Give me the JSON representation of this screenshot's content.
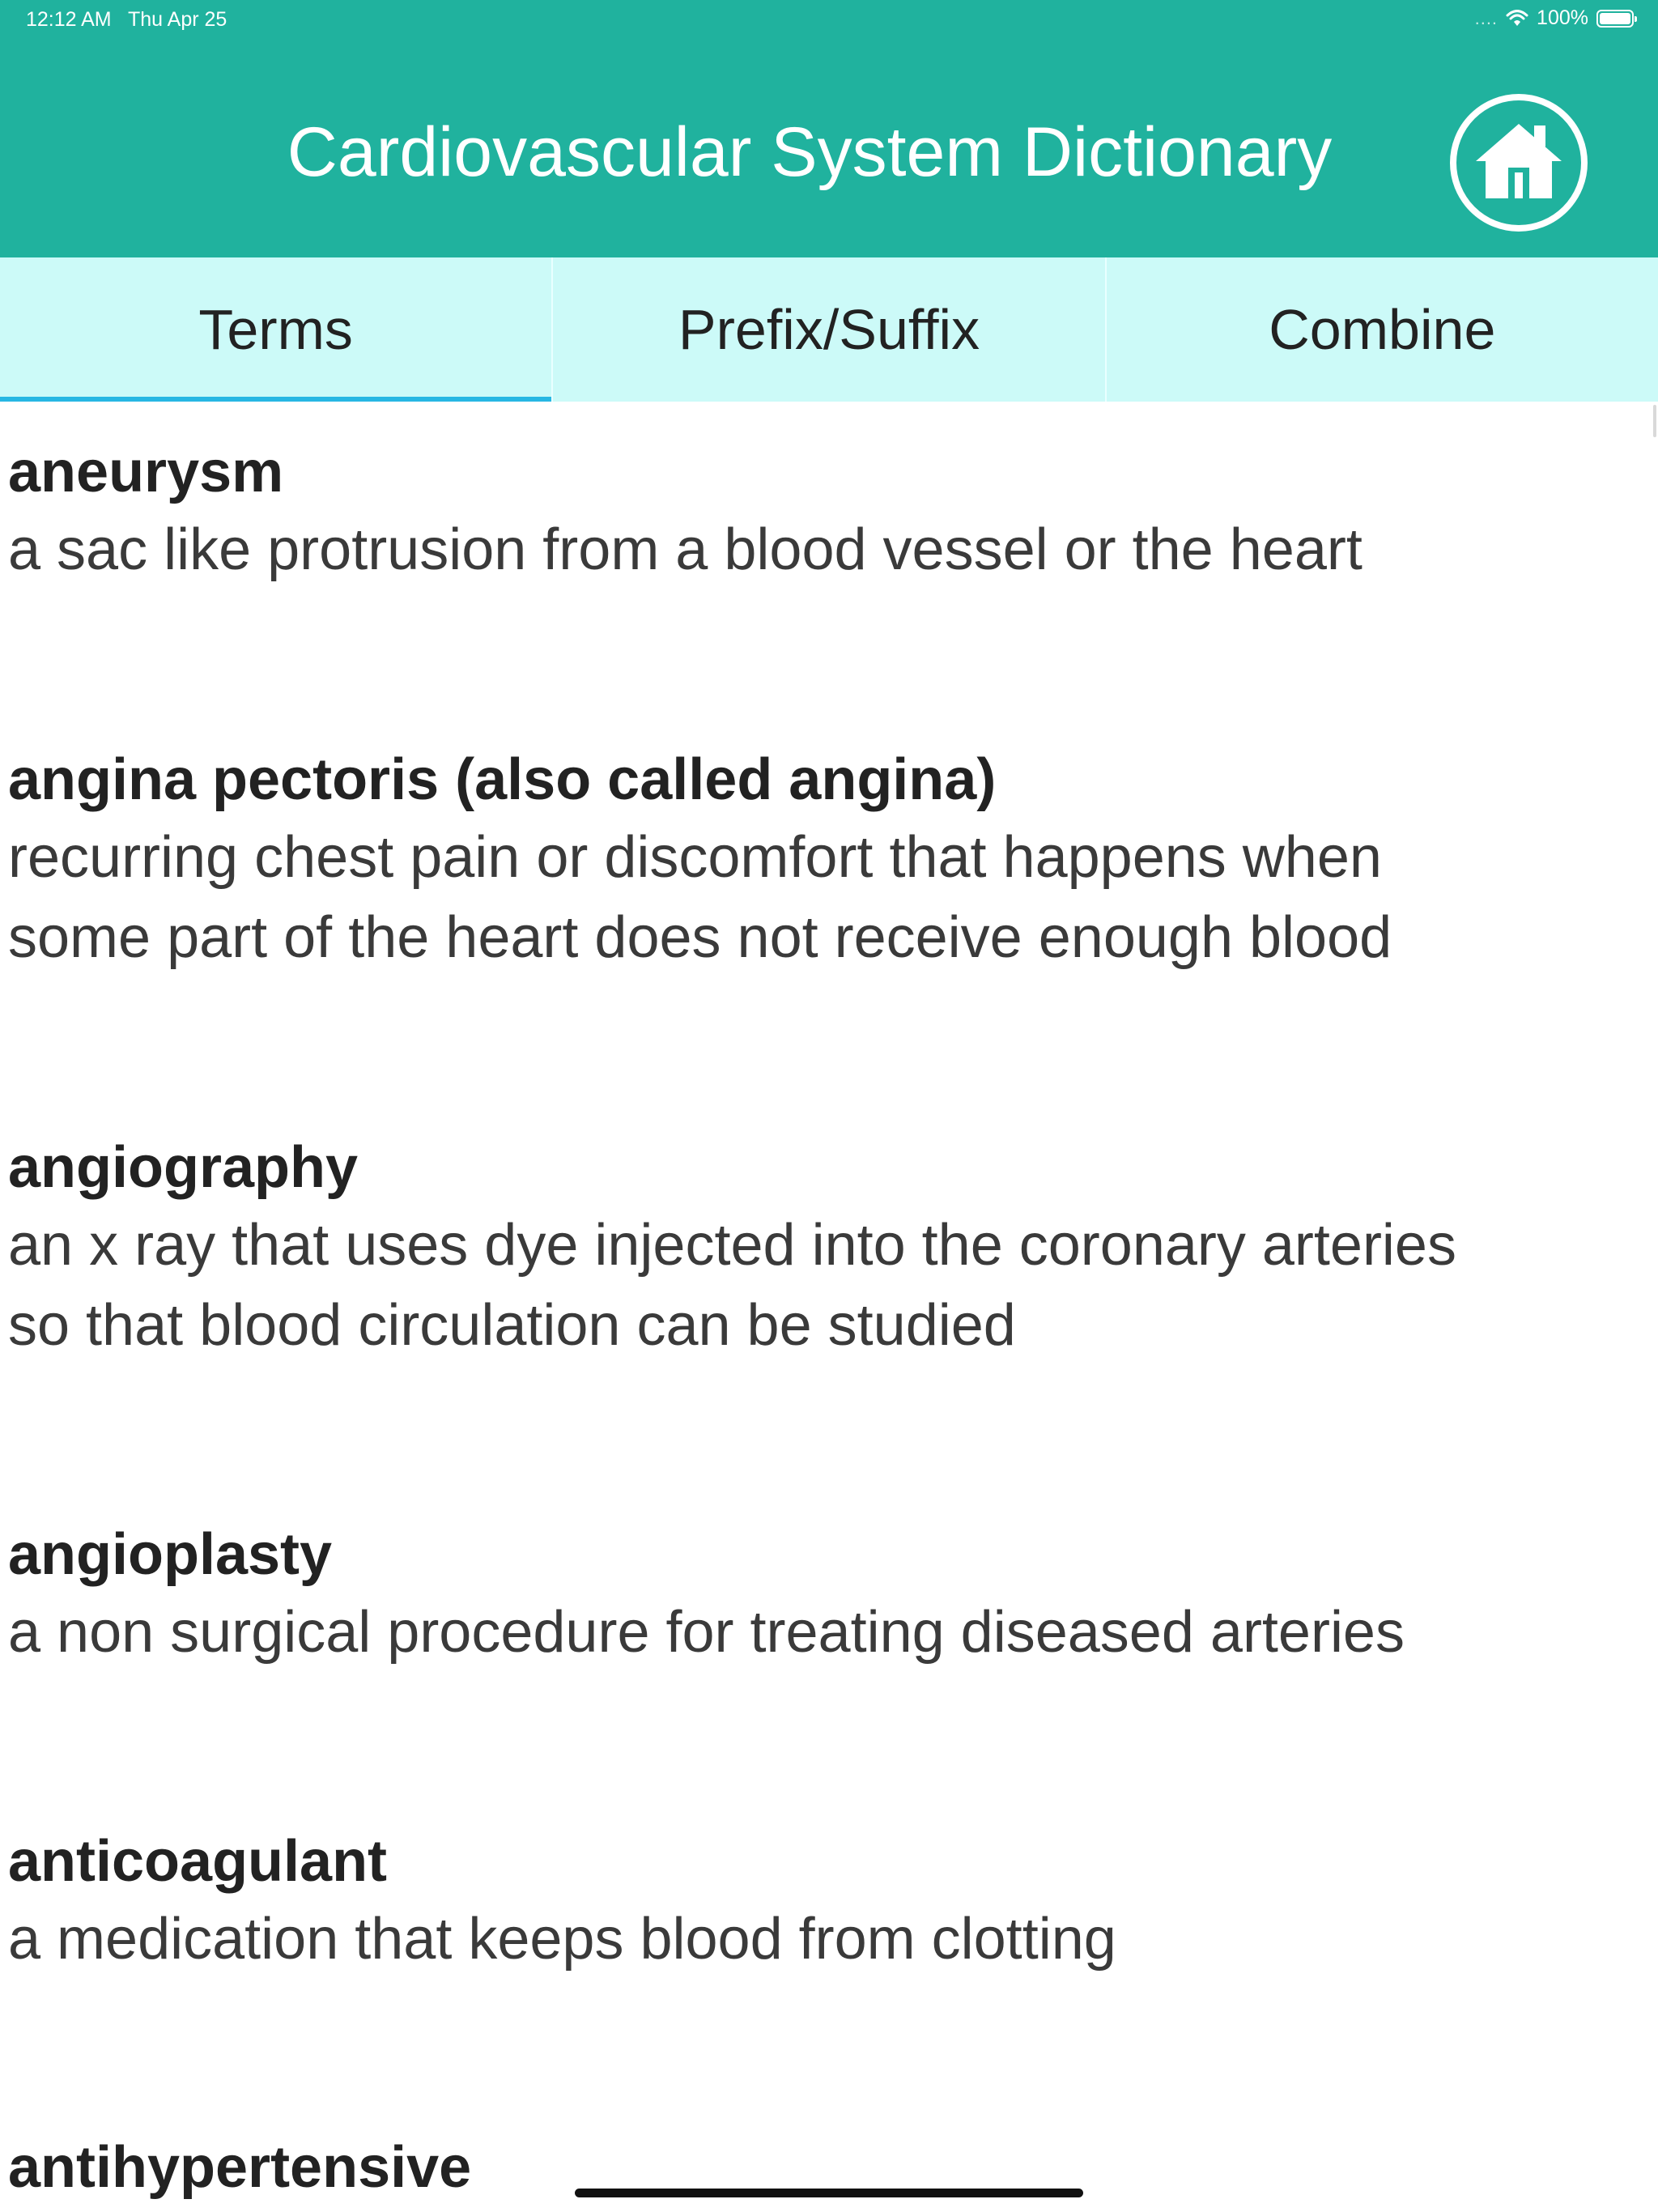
{
  "status_bar": {
    "time": "12:12 AM",
    "date": "Thu Apr 25",
    "signal": "....",
    "battery_percent": "100%"
  },
  "header": {
    "title": "Cardiovascular System Dictionary",
    "home_icon": "home-icon",
    "background_color": "#20b29e"
  },
  "tabs": [
    {
      "label": "Terms",
      "active": true
    },
    {
      "label": "Prefix/Suffix",
      "active": false
    },
    {
      "label": "Combine",
      "active": false
    }
  ],
  "entries": [
    {
      "term": "aneurysm",
      "definition_lines": [
        "a sac like protrusion from a blood vessel or the heart"
      ]
    },
    {
      "term": "angina pectoris (also called angina)",
      "definition_lines": [
        "recurring chest pain or discomfort that happens when",
        "some part of the heart does not receive enough blood"
      ]
    },
    {
      "term": "angiography",
      "definition_lines": [
        "an x ray that uses dye injected into the coronary arteries",
        "so that blood circulation can be studied"
      ]
    },
    {
      "term": "angioplasty",
      "definition_lines": [
        "a non surgical procedure for treating diseased arteries"
      ]
    },
    {
      "term": "anticoagulant",
      "definition_lines": [
        "a medication that keeps blood from clotting"
      ]
    },
    {
      "term": "antihypertensive",
      "definition_lines": []
    }
  ]
}
